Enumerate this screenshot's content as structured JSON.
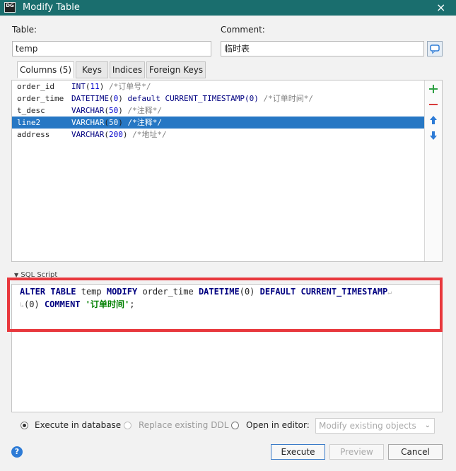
{
  "window": {
    "title": "Modify Table",
    "logo": "DG",
    "close_glyph": "×"
  },
  "form": {
    "table_label": "Table:",
    "table_value": "temp",
    "comment_label": "Comment:",
    "comment_value": "临时表"
  },
  "tabs": [
    {
      "label": "Columns (5)",
      "active": true
    },
    {
      "label": "Keys"
    },
    {
      "label": "Indices"
    },
    {
      "label": "Foreign Keys"
    }
  ],
  "columns": [
    {
      "name": "order_id",
      "type": "INT",
      "size": "11",
      "extra": "",
      "comment": "/*订单号*/"
    },
    {
      "name": "order_time",
      "type": "DATETIME",
      "size": "0",
      "extra": "default CURRENT_TIMESTAMP(0)",
      "comment": "/*订单时间*/"
    },
    {
      "name": "t_desc",
      "type": "VARCHAR",
      "size": "50",
      "extra": "",
      "comment": "/*注释*/"
    },
    {
      "name": "line2",
      "type": "VARCHAR",
      "size": "50",
      "extra": "",
      "comment": "/*注释*/",
      "selected": true
    },
    {
      "name": "address",
      "type": "VARCHAR",
      "size": "200",
      "extra": "",
      "comment": "/*地址*/"
    }
  ],
  "sidebar_buttons": [
    "add-icon",
    "remove-icon",
    "move-up-icon",
    "move-down-icon"
  ],
  "sql": {
    "header": "SQL Script",
    "line1": [
      "ALTER",
      "TABLE",
      "temp",
      "MODIFY",
      "order_time",
      "DATETIME",
      "(0)",
      "DEFAULT",
      "CURRENT_TIMESTAMP"
    ],
    "line2": [
      "(0)",
      "COMMENT",
      "'订单时间'",
      ";"
    ]
  },
  "options": {
    "execute_in_database": "Execute in database",
    "replace_existing_ddl": "Replace existing DDL",
    "open_in_editor": "Open in editor:",
    "editor_select": "Modify existing objects"
  },
  "buttons": {
    "execute": "Execute",
    "preview": "Preview",
    "cancel": "Cancel",
    "help": "?"
  },
  "colors": {
    "titlebar": "#1a6e6e",
    "selection": "#2677c4",
    "highlight_box": "#e8383d",
    "add": "#2ea043",
    "remove": "#d73a3a",
    "move": "#2d7bd6"
  }
}
